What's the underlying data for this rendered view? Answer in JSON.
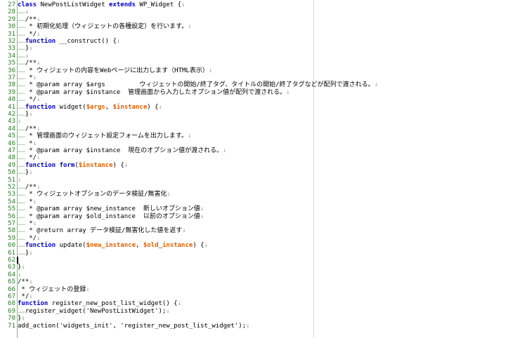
{
  "editor": {
    "colors": {
      "keyword": "#0000c0",
      "variable": "#e06000",
      "line_number": "#2a7a2a",
      "whitespace_marker": "#b0b0b0",
      "gutter_rule": "#7fbf7f"
    },
    "cursor_line": 62,
    "lines": [
      {
        "n": "27",
        "tokens": [
          {
            "t": "class",
            "c": "kw"
          },
          {
            "t": " NewPostListWidget ",
            "c": ""
          },
          {
            "t": "extends",
            "c": "kw"
          },
          {
            "t": " WP_Widget ",
            "c": ""
          },
          {
            "t": "{",
            "c": ""
          },
          {
            "t": "↓",
            "c": "eol"
          }
        ]
      },
      {
        "n": "28",
        "tokens": [
          {
            "t": "……",
            "c": "ws"
          },
          {
            "t": "↓",
            "c": "eol"
          }
        ]
      },
      {
        "n": "29",
        "tokens": [
          {
            "t": "……",
            "c": "ws"
          },
          {
            "t": "/**",
            "c": ""
          },
          {
            "t": "↓",
            "c": "eol"
          }
        ]
      },
      {
        "n": "30",
        "tokens": [
          {
            "t": "……",
            "c": "ws"
          },
          {
            "t": " * 初期化処理（ウィジェットの各種設定）を行います。",
            "c": ""
          },
          {
            "t": "↓",
            "c": "eol"
          }
        ]
      },
      {
        "n": "31",
        "tokens": [
          {
            "t": "……",
            "c": "ws"
          },
          {
            "t": " */",
            "c": ""
          },
          {
            "t": "↓",
            "c": "eol"
          }
        ]
      },
      {
        "n": "32",
        "tokens": [
          {
            "t": "……",
            "c": "ws"
          },
          {
            "t": "function",
            "c": "kw"
          },
          {
            "t": " __construct() {",
            "c": ""
          },
          {
            "t": "↓",
            "c": "eol"
          }
        ]
      },
      {
        "n": "33",
        "tokens": [
          {
            "t": "……",
            "c": "ws"
          },
          {
            "t": "}",
            "c": ""
          },
          {
            "t": "↓",
            "c": "eol"
          }
        ]
      },
      {
        "n": "34",
        "tokens": [
          {
            "t": "……",
            "c": "ws"
          },
          {
            "t": "↓",
            "c": "eol"
          }
        ]
      },
      {
        "n": "35",
        "tokens": [
          {
            "t": "……",
            "c": "ws"
          },
          {
            "t": "/**",
            "c": ""
          },
          {
            "t": "↓",
            "c": "eol"
          }
        ]
      },
      {
        "n": "36",
        "tokens": [
          {
            "t": "……",
            "c": "ws"
          },
          {
            "t": " * ウィジェットの内容をWebページに出力します（HTML表示）",
            "c": ""
          },
          {
            "t": "↓",
            "c": "eol"
          }
        ]
      },
      {
        "n": "37",
        "tokens": [
          {
            "t": "……",
            "c": "ws"
          },
          {
            "t": " *",
            "c": ""
          },
          {
            "t": "↓",
            "c": "eol"
          }
        ]
      },
      {
        "n": "38",
        "tokens": [
          {
            "t": "……",
            "c": "ws"
          },
          {
            "t": " * @param array $args         ウィジェットの開始/終了タグ、タイトルの開始/終了タグなどが配列で渡される。",
            "c": ""
          },
          {
            "t": "↓",
            "c": "eol"
          }
        ]
      },
      {
        "n": "39",
        "tokens": [
          {
            "t": "……",
            "c": "ws"
          },
          {
            "t": " * @param array $instance  管理画面から入力したオプション値が配列で渡される。",
            "c": ""
          },
          {
            "t": "↓",
            "c": "eol"
          }
        ]
      },
      {
        "n": "40",
        "tokens": [
          {
            "t": "……",
            "c": "ws"
          },
          {
            "t": " */",
            "c": ""
          },
          {
            "t": "↓",
            "c": "eol"
          }
        ]
      },
      {
        "n": "41",
        "tokens": [
          {
            "t": "……",
            "c": "ws"
          },
          {
            "t": "function",
            "c": "kw"
          },
          {
            "t": " widget(",
            "c": ""
          },
          {
            "t": "$args",
            "c": "var"
          },
          {
            "t": ", ",
            "c": ""
          },
          {
            "t": "$instance",
            "c": "var"
          },
          {
            "t": ") {",
            "c": ""
          },
          {
            "t": "↓",
            "c": "eol"
          }
        ]
      },
      {
        "n": "42",
        "tokens": [
          {
            "t": "……",
            "c": "ws"
          },
          {
            "t": "}",
            "c": ""
          },
          {
            "t": "↓",
            "c": "eol"
          }
        ]
      },
      {
        "n": "43",
        "tokens": [
          {
            "t": "↓",
            "c": "eol"
          }
        ]
      },
      {
        "n": "44",
        "tokens": [
          {
            "t": "……",
            "c": "ws"
          },
          {
            "t": "/**",
            "c": ""
          },
          {
            "t": "↓",
            "c": "eol"
          }
        ]
      },
      {
        "n": "45",
        "tokens": [
          {
            "t": "……",
            "c": "ws"
          },
          {
            "t": " * 管理画面のウィジェット設定フォームを出力します。",
            "c": ""
          },
          {
            "t": "↓",
            "c": "eol"
          }
        ]
      },
      {
        "n": "46",
        "tokens": [
          {
            "t": "……",
            "c": "ws"
          },
          {
            "t": " *",
            "c": ""
          },
          {
            "t": "↓",
            "c": "eol"
          }
        ]
      },
      {
        "n": "47",
        "tokens": [
          {
            "t": "……",
            "c": "ws"
          },
          {
            "t": " * @param array $instance  現在のオプション値が渡される。",
            "c": ""
          },
          {
            "t": "↓",
            "c": "eol"
          }
        ]
      },
      {
        "n": "48",
        "tokens": [
          {
            "t": "……",
            "c": "ws"
          },
          {
            "t": " */",
            "c": ""
          },
          {
            "t": "↓",
            "c": "eol"
          }
        ]
      },
      {
        "n": "49",
        "tokens": [
          {
            "t": "……",
            "c": "ws"
          },
          {
            "t": "function",
            "c": "kw"
          },
          {
            "t": " ",
            "c": ""
          },
          {
            "t": "form",
            "c": "kw"
          },
          {
            "t": "(",
            "c": ""
          },
          {
            "t": "$instance",
            "c": "var"
          },
          {
            "t": ") {",
            "c": ""
          },
          {
            "t": "↓",
            "c": "eol"
          }
        ]
      },
      {
        "n": "50",
        "tokens": [
          {
            "t": "……",
            "c": "ws"
          },
          {
            "t": "}",
            "c": ""
          },
          {
            "t": "↓",
            "c": "eol"
          }
        ]
      },
      {
        "n": "51",
        "tokens": [
          {
            "t": "↓",
            "c": "eol"
          }
        ]
      },
      {
        "n": "52",
        "tokens": [
          {
            "t": "……",
            "c": "ws"
          },
          {
            "t": "/**",
            "c": ""
          },
          {
            "t": "↓",
            "c": "eol"
          }
        ]
      },
      {
        "n": "53",
        "tokens": [
          {
            "t": "……",
            "c": "ws"
          },
          {
            "t": " * ウィジェットオプションのデータ検証/無害化",
            "c": ""
          },
          {
            "t": "↓",
            "c": "eol"
          }
        ]
      },
      {
        "n": "54",
        "tokens": [
          {
            "t": "……",
            "c": "ws"
          },
          {
            "t": " *",
            "c": ""
          },
          {
            "t": "↓",
            "c": "eol"
          }
        ]
      },
      {
        "n": "55",
        "tokens": [
          {
            "t": "……",
            "c": "ws"
          },
          {
            "t": " * @param array $new_instance  新しいオプション値",
            "c": ""
          },
          {
            "t": "↓",
            "c": "eol"
          }
        ]
      },
      {
        "n": "56",
        "tokens": [
          {
            "t": "……",
            "c": "ws"
          },
          {
            "t": " * @param array $old_instance  以前のオプション値",
            "c": ""
          },
          {
            "t": "↓",
            "c": "eol"
          }
        ]
      },
      {
        "n": "57",
        "tokens": [
          {
            "t": "……",
            "c": "ws"
          },
          {
            "t": " *",
            "c": ""
          },
          {
            "t": "↓",
            "c": "eol"
          }
        ]
      },
      {
        "n": "58",
        "tokens": [
          {
            "t": "……",
            "c": "ws"
          },
          {
            "t": " * @return array データ検証/無害化した値を返す",
            "c": ""
          },
          {
            "t": "↓",
            "c": "eol"
          }
        ]
      },
      {
        "n": "59",
        "tokens": [
          {
            "t": "……",
            "c": "ws"
          },
          {
            "t": " */",
            "c": ""
          },
          {
            "t": "↓",
            "c": "eol"
          }
        ]
      },
      {
        "n": "60",
        "tokens": [
          {
            "t": "……",
            "c": "ws"
          },
          {
            "t": "function",
            "c": "kw"
          },
          {
            "t": " update(",
            "c": ""
          },
          {
            "t": "$new_instance",
            "c": "var"
          },
          {
            "t": ", ",
            "c": ""
          },
          {
            "t": "$old_instance",
            "c": "var"
          },
          {
            "t": ") {",
            "c": ""
          },
          {
            "t": "↓",
            "c": "eol"
          }
        ]
      },
      {
        "n": "61",
        "tokens": [
          {
            "t": "……",
            "c": "ws"
          },
          {
            "t": "}",
            "c": ""
          },
          {
            "t": "↓",
            "c": "eol"
          }
        ]
      },
      {
        "n": "62",
        "tokens": [
          {
            "t": "",
            "c": ""
          }
        ]
      },
      {
        "n": "63",
        "tokens": [
          {
            "t": "}",
            "c": ""
          },
          {
            "t": "↓",
            "c": "eol"
          }
        ]
      },
      {
        "n": "64",
        "tokens": [
          {
            "t": "↓",
            "c": "eol"
          }
        ]
      },
      {
        "n": "65",
        "tokens": [
          {
            "t": "/**",
            "c": ""
          },
          {
            "t": "↓",
            "c": "eol"
          }
        ]
      },
      {
        "n": "66",
        "tokens": [
          {
            "t": " * ウィジェットの登録",
            "c": ""
          },
          {
            "t": "↓",
            "c": "eol"
          }
        ]
      },
      {
        "n": "67",
        "tokens": [
          {
            "t": " */",
            "c": ""
          },
          {
            "t": "↓",
            "c": "eol"
          }
        ]
      },
      {
        "n": "68",
        "tokens": [
          {
            "t": "function",
            "c": "kw"
          },
          {
            "t": " register_new_post_list_widget() {",
            "c": ""
          },
          {
            "t": "↓",
            "c": "eol"
          }
        ]
      },
      {
        "n": "69",
        "tokens": [
          {
            "t": "……",
            "c": "ws"
          },
          {
            "t": "register_widget('NewPostListWidget');",
            "c": ""
          },
          {
            "t": "↓",
            "c": "eol"
          }
        ]
      },
      {
        "n": "70",
        "tokens": [
          {
            "t": "}",
            "c": ""
          },
          {
            "t": "↓",
            "c": "eol"
          }
        ]
      },
      {
        "n": "71",
        "tokens": [
          {
            "t": "add_action('widgets_init', 'register_new_post_list_widget');",
            "c": ""
          },
          {
            "t": "↓",
            "c": "eol"
          }
        ]
      }
    ]
  }
}
